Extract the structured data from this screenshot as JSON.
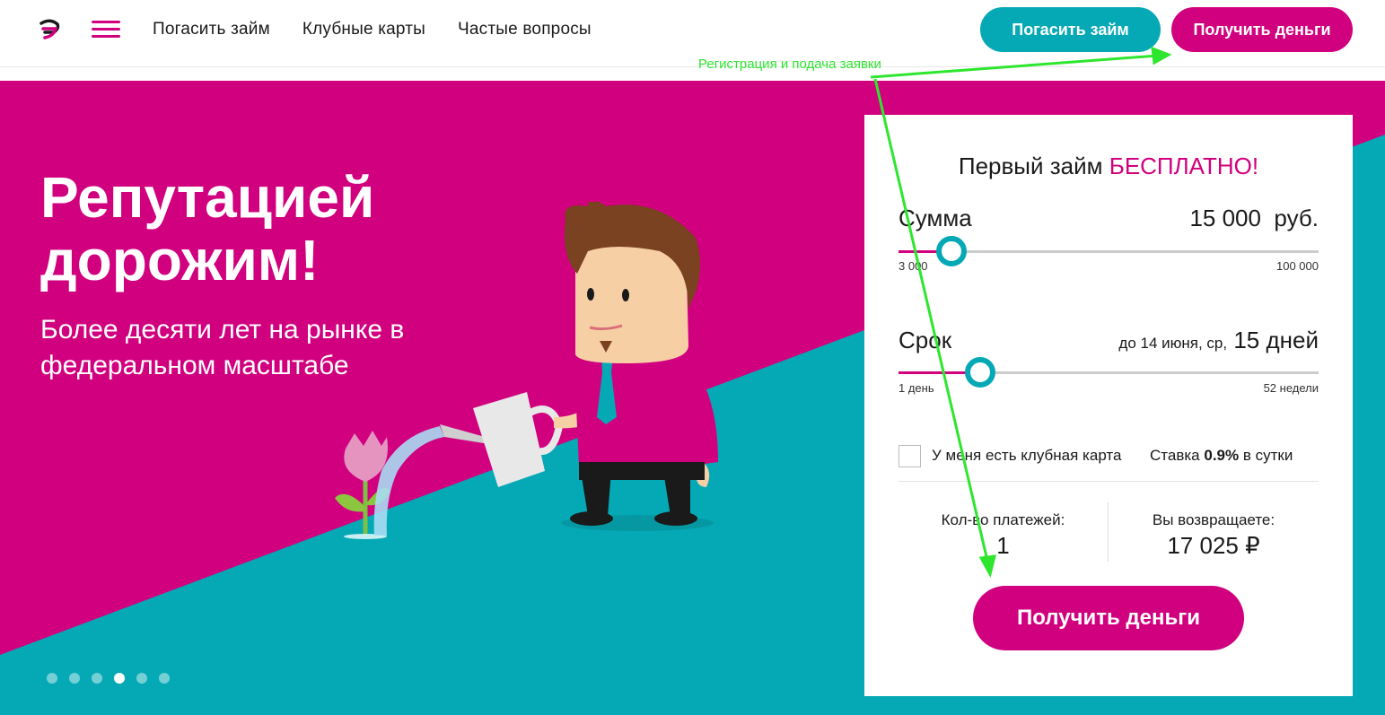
{
  "colors": {
    "accent": "#d1007e",
    "secondary": "#05a9b5",
    "annotation": "#2ee62e"
  },
  "header": {
    "logo_icon": "brand-logo-icon",
    "menu_icon": "hamburger-menu-icon",
    "nav": [
      "Погасить займ",
      "Клубные карты",
      "Частые вопросы"
    ],
    "repay_button": "Погасить займ",
    "get_money_button": "Получить деньги"
  },
  "annotation": {
    "text": "Регистрация и подача заявки"
  },
  "hero": {
    "title_line1": "Репутацией",
    "title_line2": "дорожим!",
    "subtitle": "Более десяти лет на рынке в федеральном масштабе",
    "slide_count": 6,
    "active_slide": 4
  },
  "calculator": {
    "title_prefix": "Первый займ",
    "title_highlight": "БЕСПЛАТНО!",
    "amount": {
      "label": "Сумма",
      "value": "15 000",
      "unit": "руб.",
      "min_label": "3 000",
      "max_label": "100 000",
      "level": 0.125
    },
    "term": {
      "label": "Срок",
      "until": "до 14 июня, ср,",
      "value": "15 дней",
      "min_label": "1 день",
      "max_label": "52 недели",
      "level": 0.195
    },
    "club_card_label": "У меня есть клубная карта",
    "club_card_checked": false,
    "rate_prefix": "Ставка",
    "rate_value": "0.9%",
    "rate_suffix": "в сутки",
    "payments_label": "Кол-во платежей:",
    "payments_value": "1",
    "return_label": "Вы возвращаете:",
    "return_value": "17 025 ₽",
    "submit_button": "Получить деньги"
  }
}
